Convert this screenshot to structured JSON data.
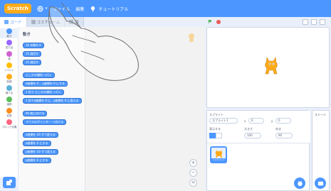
{
  "menubar": {
    "logo_text": "Scratch",
    "items": [
      {
        "label": "",
        "icon": "globe-icon"
      },
      {
        "label": "ファイル",
        "icon": ""
      },
      {
        "label": "編集",
        "icon": ""
      },
      {
        "label": "チュートリアル",
        "icon": "lightbulb-icon"
      }
    ]
  },
  "tabs": [
    {
      "label": "コード",
      "icon": "code-icon",
      "active": true
    },
    {
      "label": "コスチューム",
      "icon": "brush-icon",
      "active": false
    },
    {
      "label": "音",
      "icon": "sound-icon",
      "active": false
    }
  ],
  "categories": [
    {
      "label": "動き",
      "color": "#4c97ff",
      "selected": true
    },
    {
      "label": "見た目",
      "color": "#9966ff",
      "selected": false
    },
    {
      "label": "音",
      "color": "#cf63cf",
      "selected": false
    },
    {
      "label": "イベント",
      "color": "#ffbf00",
      "selected": false
    },
    {
      "label": "制御",
      "color": "#ffab19",
      "selected": false
    },
    {
      "label": "調べる",
      "color": "#5cb1d6",
      "selected": false
    },
    {
      "label": "演算",
      "color": "#59c059",
      "selected": false
    },
    {
      "label": "変数",
      "color": "#ff8c1a",
      "selected": false
    },
    {
      "label": "ブロック定義",
      "color": "#ff6680",
      "selected": false
    }
  ],
  "palette": {
    "title": "動き",
    "blocks": [
      {
        "label": "10 歩動かす",
        "value": "10"
      },
      {
        "label": "15 度回す",
        "value": "15"
      },
      {
        "label": "15 度回す",
        "value": "15"
      },
      {
        "label": "どこかの場所 へ行く",
        "value": ""
      },
      {
        "label": "x座標を 0 、y座標を 0 にする",
        "value": "0"
      },
      {
        "label": "1 秒で どこかの場所 へ行く",
        "value": "1"
      },
      {
        "label": "1 秒でx座標を 0 に、y座標を 0 に変える",
        "value": "1"
      },
      {
        "label": "90 度に向ける",
        "value": "90"
      },
      {
        "label": "マウスのポインター へ向ける",
        "value": ""
      },
      {
        "label": "x座標を 10 ずつ変える",
        "value": "10"
      },
      {
        "label": "x座標を 0 にする",
        "value": "0"
      },
      {
        "label": "y座標を 10 ずつ変える",
        "value": "10"
      },
      {
        "label": "y座標を 0 にする",
        "value": "0"
      }
    ]
  },
  "sprite_info": {
    "sprite_label": "スプライト",
    "sprite_name": "スプライト1",
    "x_label": "x",
    "x_value": "0",
    "y_label": "y",
    "y_value": "0",
    "show_label": "表示する",
    "size_label": "大きさ",
    "size_value": "100",
    "direction_label": "向き",
    "direction_value": "90"
  },
  "stage_target": {
    "label": "ステージ"
  },
  "colors": {
    "accent": "#4c97ff",
    "menubar": "#4c97ff",
    "logo": "#ffab19",
    "stop": "#ec5959",
    "flag": "#4cbf56"
  }
}
